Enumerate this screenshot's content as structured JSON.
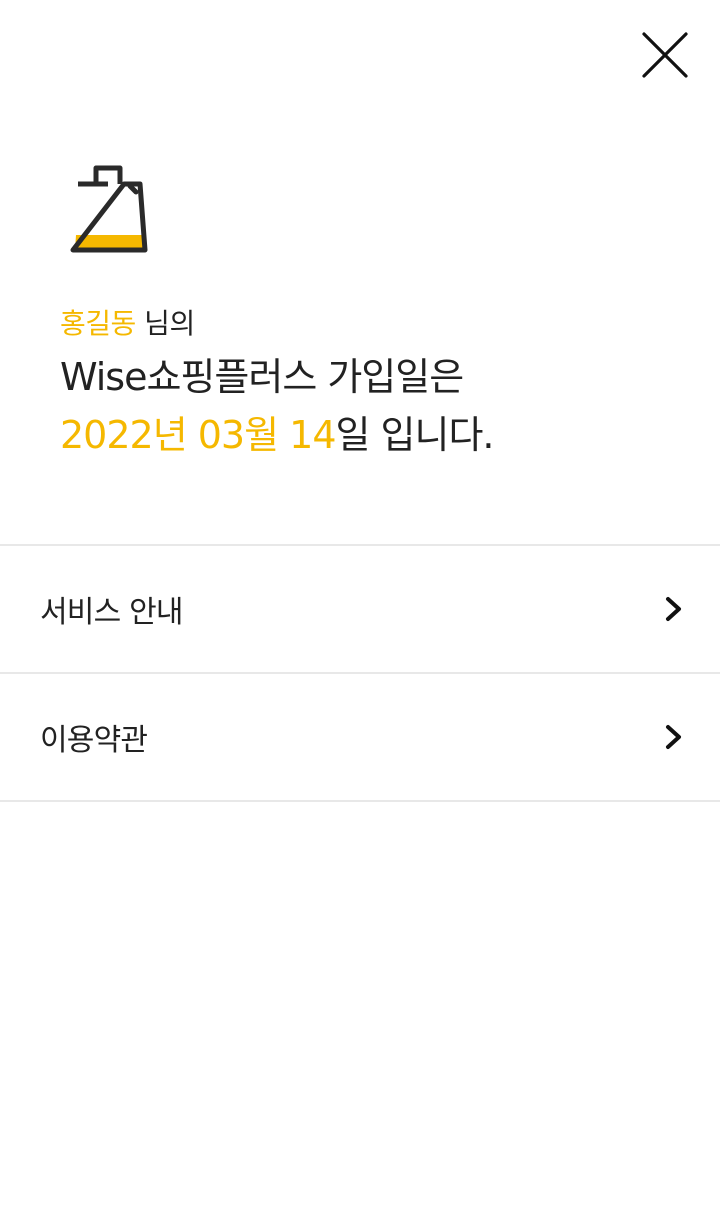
{
  "header": {
    "close_icon": "close-icon"
  },
  "hero": {
    "icon": "shopping-bag-icon",
    "accent_color": "#f5b800"
  },
  "greeting": {
    "name": "홍길동",
    "name_suffix": " 님의",
    "service_line": "Wise쇼핑플러스 가입일은",
    "date": "2022년 03월 14",
    "date_suffix": "일 입니다."
  },
  "menu": {
    "items": [
      {
        "label": "서비스 안내",
        "icon": "chevron-right-icon"
      },
      {
        "label": "이용약관",
        "icon": "chevron-right-icon"
      }
    ]
  },
  "colors": {
    "accent": "#f5b800",
    "text": "#222222",
    "divider": "#e8e8e8"
  }
}
